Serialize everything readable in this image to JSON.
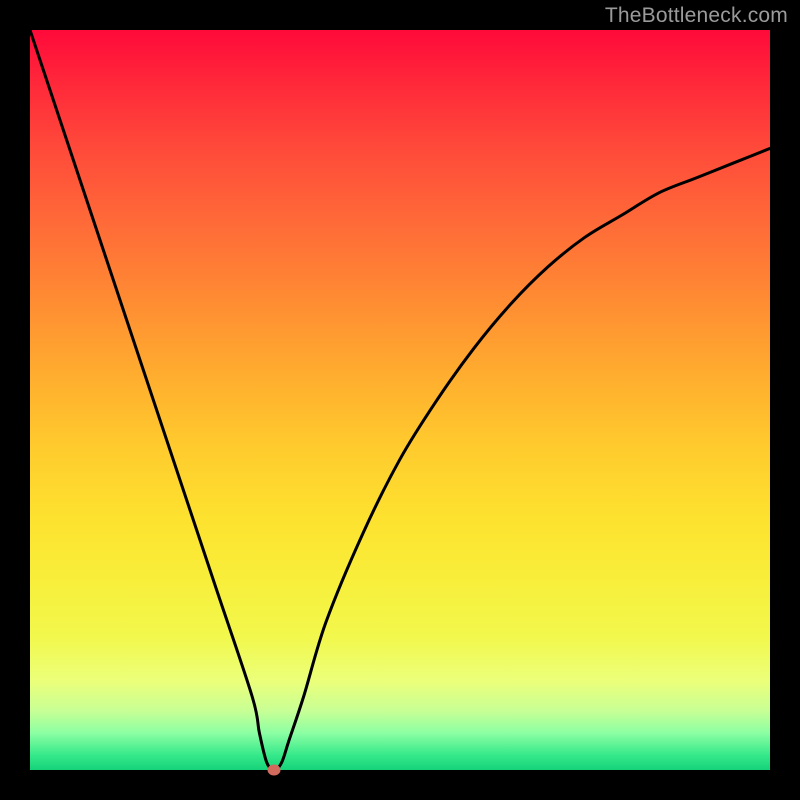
{
  "watermark": "TheBottleneck.com",
  "colors": {
    "frame_bg": "#000000",
    "gradient_top": "#ff0a3a",
    "gradient_bottom": "#16d27a",
    "curve_stroke": "#000000",
    "marker_fill": "#d36a5e",
    "watermark_text": "#9a9a9a"
  },
  "chart_data": {
    "type": "line",
    "title": "",
    "xlabel": "",
    "ylabel": "",
    "xlim": [
      0,
      100
    ],
    "ylim": [
      0,
      100
    ],
    "grid": false,
    "legend": false,
    "series": [
      {
        "name": "bottleneck-curve",
        "x": [
          0,
          5,
          10,
          15,
          20,
          25,
          30,
          31,
          32,
          33,
          34,
          35,
          37,
          40,
          45,
          50,
          55,
          60,
          65,
          70,
          75,
          80,
          85,
          90,
          95,
          100
        ],
        "y": [
          100,
          85,
          70,
          55,
          40,
          25,
          10,
          5,
          1,
          0,
          1,
          4,
          10,
          20,
          32,
          42,
          50,
          57,
          63,
          68,
          72,
          75,
          78,
          80,
          82,
          84
        ]
      }
    ],
    "marker": {
      "x": 33,
      "y": 0
    }
  }
}
